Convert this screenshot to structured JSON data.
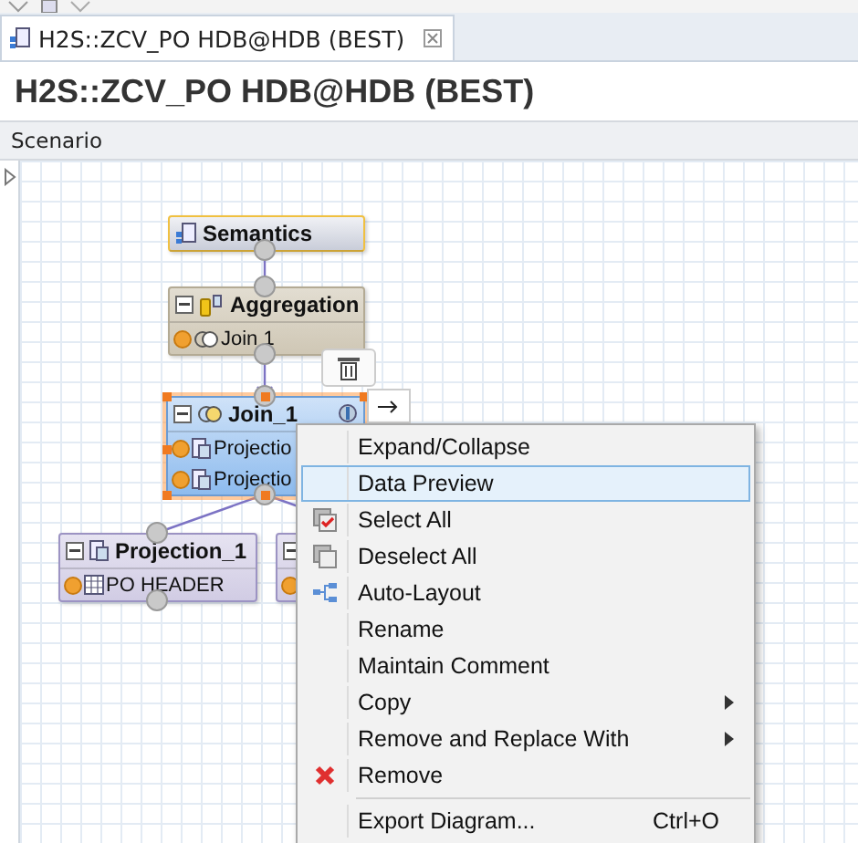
{
  "tab": {
    "title": "H2S::ZCV_PO HDB@HDB (BEST)",
    "selected": true
  },
  "heading": "H2S::ZCV_PO HDB@HDB (BEST)",
  "section": "Scenario",
  "nodes": [
    {
      "kind": "semantics",
      "title": "Semantics",
      "selected": false
    },
    {
      "kind": "aggregation",
      "title": "Aggregation",
      "selected": false,
      "rows": [
        "Join 1"
      ]
    },
    {
      "kind": "join",
      "title": "Join_1",
      "selected": true,
      "rows": [
        "Projectio",
        "Projectio"
      ]
    },
    {
      "kind": "projection",
      "title": "Projection_1",
      "selected": false,
      "rows": [
        "PO HEADER"
      ]
    },
    {
      "kind": "projection",
      "selected": false,
      "rows": [
        ""
      ]
    }
  ],
  "context_menu": {
    "items": [
      {
        "kind": "plain",
        "label": "Expand/Collapse",
        "selected": false
      },
      {
        "kind": "plain",
        "label": "Data Preview",
        "selected": true
      },
      {
        "kind": "select",
        "label": "Select All",
        "selected": false
      },
      {
        "kind": "deselect",
        "label": "Deselect All",
        "selected": false
      },
      {
        "kind": "layout",
        "label": "Auto-Layout",
        "selected": false
      },
      {
        "kind": "plain",
        "label": "Rename",
        "selected": false
      },
      {
        "kind": "plain",
        "label": "Maintain Comment",
        "selected": false
      },
      {
        "kind": "plain",
        "label": "Copy",
        "selected": false,
        "submenu": true
      },
      {
        "kind": "plain",
        "label": "Remove and Replace With",
        "selected": false,
        "submenu": true
      },
      {
        "kind": "remove",
        "label": "Remove",
        "selected": false
      },
      {
        "kind": "plain",
        "label": "Export Diagram...",
        "selected": false,
        "shortcut": "Ctrl+O",
        "separator_before": true
      }
    ]
  }
}
